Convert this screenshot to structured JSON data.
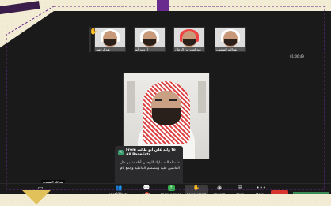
{
  "participants": [
    {
      "name": "عبدالله الصفوب",
      "x_hint": "a"
    },
    {
      "name": "عبدالعزيز بن الرمان",
      "x_hint": "b"
    },
    {
      "name": "أ. وليد أبو",
      "x_hint": "c"
    },
    {
      "name": "عبدالرحمن",
      "x_hint": "d"
    },
    {
      "name": "Anas Alrabeah",
      "x_hint": "e"
    }
  ],
  "clock": "01:06:49",
  "chat_popup": {
    "header": "From وليد علي أبو طالب to All Panelists",
    "message": "ما شاء الله تبارك الرحمن أداء متميز مثل القائمين عليه وبتصميم الفاعلية وجمع تام"
  },
  "active_speaker_name": "عبدالله الصفوب",
  "toolbar": {
    "start_video": "Start Video",
    "participants": "Participants",
    "participants_count": "234",
    "chat": "Chat",
    "chat_badge": "3",
    "share_screen": "Share Screen",
    "lower_hand": "Lower Hand",
    "record": "Record",
    "apps": "Apps",
    "more": "More"
  }
}
